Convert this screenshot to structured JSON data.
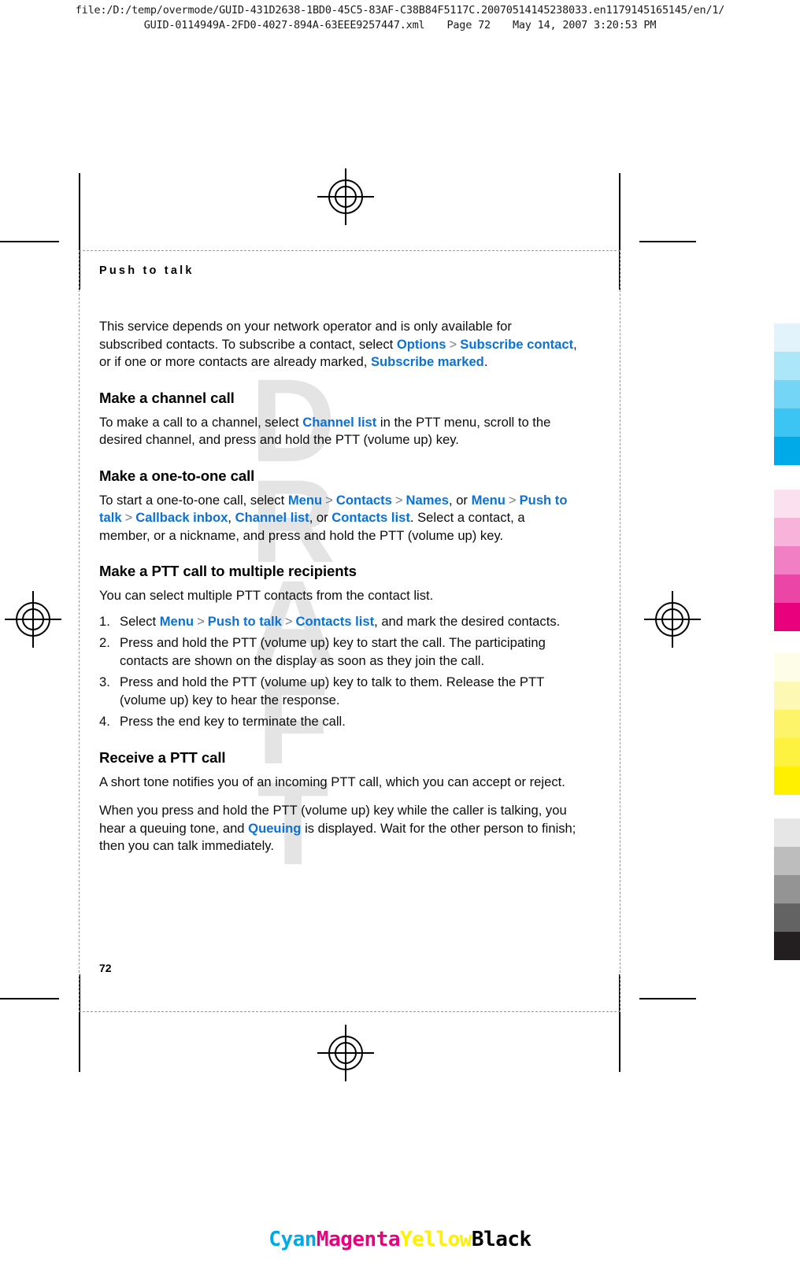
{
  "prepress": {
    "header_line1": "file:/D:/temp/overmode/GUID-431D2638-1BD0-45C5-83AF-C38B84F5117C.20070514145238033.en1179145165145/en/1/",
    "header_file": "GUID-0114949A-2FD0-4027-894A-63EEE9257447.xml",
    "header_page": "Page 72",
    "header_date": "May 14, 2007 3:20:53 PM",
    "watermark": "DRAFT",
    "watermark_letters": [
      "D",
      "R",
      "A",
      "F",
      "T"
    ]
  },
  "document": {
    "running_head": "Push to talk",
    "folio": "72",
    "intro": {
      "t1": "This service depends on your network operator and is only available for subscribed contacts. To subscribe a contact, select ",
      "ui1": "Options",
      "sep1": ">",
      "ui2": "Subscribe contact",
      "t2": ", or if one or more contacts are already marked, ",
      "ui3": "Subscribe marked",
      "t3": "."
    },
    "sections": [
      {
        "heading": "Make a channel call",
        "p": {
          "t1": "To make a call to a channel, select ",
          "ui1": "Channel list",
          "t2": " in the PTT menu, scroll to the desired channel, and press and hold the PTT (volume up) key."
        }
      },
      {
        "heading": "Make a one-to-one call",
        "p": {
          "t1": "To start a one-to-one call, select ",
          "ui1": "Menu",
          "sep1": ">",
          "ui2": "Contacts",
          "sep2": ">",
          "ui3": "Names",
          "t2": ", or ",
          "ui4": "Menu",
          "sep3": ">",
          "ui5": "Push to talk",
          "sep4": ">",
          "ui6": "Callback inbox",
          "t3": ", ",
          "ui7": "Channel list",
          "t4": ", or ",
          "ui8": "Contacts list",
          "t5": ". Select a contact, a member, or a nickname, and press and hold the PTT (volume up) key."
        }
      },
      {
        "heading": "Make a PTT call to multiple recipients",
        "lead": "You can select multiple PTT contacts from the contact list.",
        "steps": [
          {
            "num": "1.",
            "t1": "Select ",
            "ui1": "Menu",
            "sep1": ">",
            "ui2": "Push to talk",
            "sep2": ">",
            "ui3": "Contacts list",
            "t2": ", and mark the desired contacts."
          },
          {
            "num": "2.",
            "t1": "Press and hold the PTT (volume up) key to start the call. The participating contacts are shown on the display as soon as they join the call."
          },
          {
            "num": "3.",
            "t1": "Press and hold the PTT (volume up) key to talk to them. Release the PTT (volume up) key to hear the response."
          },
          {
            "num": "4.",
            "t1": "Press the end key to terminate the call."
          }
        ]
      },
      {
        "heading": "Receive a PTT call",
        "p1": "A short tone notifies you of an incoming PTT call, which you can accept or reject.",
        "p2": {
          "t1": "When you press and hold the PTT (volume up) key while the caller is talking, you hear a queuing tone, and ",
          "ui1": "Queuing",
          "t2": " is displayed. Wait for the other person to finish; then you can talk immediately."
        }
      }
    ]
  },
  "colors": {
    "ui_link": "#0b72d4",
    "watermark": "#e4e4e4",
    "cyan_ramp": [
      "#e2f3fc",
      "#ace6f9",
      "#74d5f6",
      "#3cc4f2",
      "#00a9e8"
    ],
    "magenta_ramp": [
      "#fbe0ef",
      "#f7b3da",
      "#f07fc3",
      "#ec45a8",
      "#e8007d"
    ],
    "yellow_ramp": [
      "#fefde8",
      "#fdf8b4",
      "#fdf469",
      "#fdf23f",
      "#fff000"
    ],
    "black_ramp": [
      "#e6e6e6",
      "#bdbdbd",
      "#949494",
      "#636363",
      "#231f20"
    ]
  },
  "color_footer": [
    {
      "label": "Cyan",
      "color": "#00a9e8"
    },
    {
      "label": "Magenta",
      "color": "#e8007d"
    },
    {
      "label": "Yellow",
      "color": "#fff000"
    },
    {
      "label": "Black",
      "color": "#000000"
    }
  ]
}
